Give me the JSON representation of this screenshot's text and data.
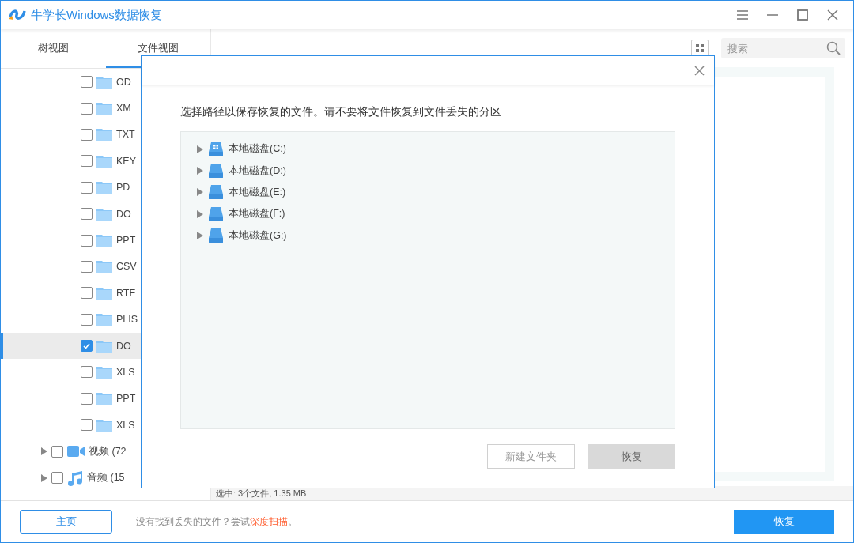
{
  "window": {
    "title": "牛学长Windows数据恢复"
  },
  "tabs": [
    {
      "label": "树视图",
      "selected": false
    },
    {
      "label": "文件视图",
      "selected": true
    }
  ],
  "tree": [
    {
      "kind": "folder",
      "label": "OD",
      "checked": false,
      "selected": false
    },
    {
      "kind": "folder",
      "label": "XM",
      "checked": false,
      "selected": false
    },
    {
      "kind": "folder",
      "label": "TXT",
      "checked": false,
      "selected": false
    },
    {
      "kind": "folder",
      "label": "KEY",
      "checked": false,
      "selected": false
    },
    {
      "kind": "folder",
      "label": "PD",
      "checked": false,
      "selected": false
    },
    {
      "kind": "folder",
      "label": "DO",
      "checked": false,
      "selected": false
    },
    {
      "kind": "folder",
      "label": "PPT",
      "checked": false,
      "selected": false
    },
    {
      "kind": "folder",
      "label": "CSV",
      "checked": false,
      "selected": false
    },
    {
      "kind": "folder",
      "label": "RTF",
      "checked": false,
      "selected": false
    },
    {
      "kind": "folder",
      "label": "PLIS",
      "checked": false,
      "selected": false
    },
    {
      "kind": "folder",
      "label": "DO",
      "checked": true,
      "selected": true
    },
    {
      "kind": "folder",
      "label": "XLS",
      "checked": false,
      "selected": false
    },
    {
      "kind": "folder",
      "label": "PPT",
      "checked": false,
      "selected": false
    },
    {
      "kind": "folder",
      "label": "XLS",
      "checked": false,
      "selected": false
    },
    {
      "kind": "video",
      "label": "视频 (72",
      "checked": false,
      "selected": false
    },
    {
      "kind": "audio",
      "label": "音频 (15",
      "checked": false,
      "selected": false
    }
  ],
  "search": {
    "placeholder": "搜索"
  },
  "status_bar": "选中: 3个文件, 1.35 MB",
  "footer": {
    "home_button": "主页",
    "hint": "没有找到丢失的文件？尝试",
    "hint_link": "深度扫描",
    "hint_end": "。",
    "recover_button": "恢复"
  },
  "dialog": {
    "message": "选择路径以保存恢复的文件。请不要将文件恢复到文件丢失的分区",
    "drives": [
      {
        "label": "本地磁盘(C:)",
        "kind": "system"
      },
      {
        "label": "本地磁盘(D:)",
        "kind": "disk"
      },
      {
        "label": "本地磁盘(E:)",
        "kind": "disk"
      },
      {
        "label": "本地磁盘(F:)",
        "kind": "disk"
      },
      {
        "label": "本地磁盘(G:)",
        "kind": "disk"
      }
    ],
    "new_folder_button": "新建文件夹",
    "recover_button": {
      "label": "恢复",
      "disabled": true
    }
  }
}
